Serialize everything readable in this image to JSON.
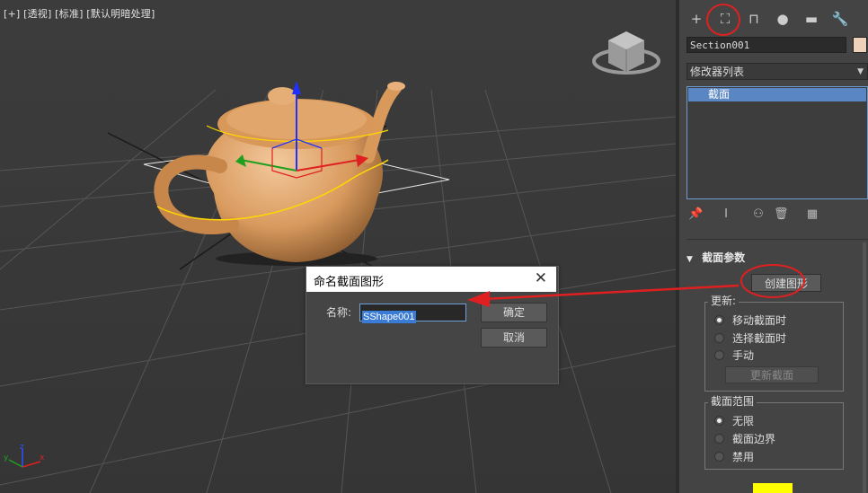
{
  "viewport": {
    "label": "[+] [透视] [标准] [默认明暗处理]",
    "axis_labels": {
      "z": "z",
      "x": "x",
      "y": "y"
    }
  },
  "panel": {
    "tabs": [
      {
        "icon": "plus-icon",
        "glyph": "+"
      },
      {
        "icon": "modify-icon",
        "glyph": "⛶"
      },
      {
        "icon": "hierarchy-icon",
        "glyph": "⊓"
      },
      {
        "icon": "motion-icon",
        "glyph": "●"
      },
      {
        "icon": "display-icon",
        "glyph": "▬"
      },
      {
        "icon": "utilities-icon",
        "glyph": "🔧"
      }
    ],
    "object_name": "Section001",
    "object_color": "#efd2ba",
    "modifier_list": "修改器列表",
    "stack_item": "截面",
    "rollout_title": "截面参数",
    "create_shape_button": "创建图形",
    "update_group": {
      "label": "更新:",
      "options": [
        "移动截面时",
        "选择截面时",
        "手动"
      ],
      "selected": 0,
      "update_button": "更新截面"
    },
    "range_group": {
      "label": "截面范围",
      "options": [
        "无限",
        "截面边界",
        "禁用"
      ],
      "selected": 0
    },
    "section_color": "#ffff00"
  },
  "dialog": {
    "title": "命名截面图形",
    "close": "✕",
    "name_label": "名称:",
    "name_value": "SShape001",
    "ok_button": "确定",
    "cancel_button": "取消"
  },
  "annotation_color": "#e02020"
}
